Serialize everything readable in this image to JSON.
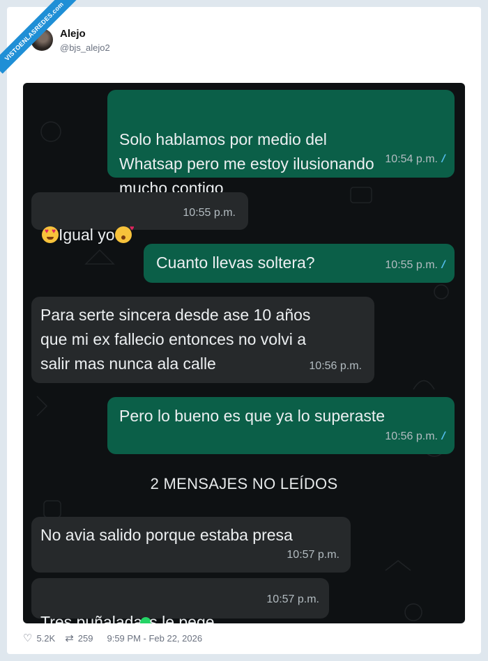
{
  "watermark": "VISTOENLASREDES.com",
  "author": {
    "name": "Alejo",
    "handle": "@bjs_alejo2"
  },
  "messages": [
    {
      "dir": "out",
      "text": "Solo hablamos por medio del\nWhatsap pero me estoy ilusionando\nmucho contigo",
      "time": "10:54 p.m."
    },
    {
      "dir": "in",
      "text": "Igual yo",
      "time": "10:55 p.m."
    },
    {
      "dir": "out",
      "text": "Cuanto llevas soltera?",
      "time": "10:55 p.m."
    },
    {
      "dir": "in",
      "text": "Para serte sincera desde ase 10 años\nque mi ex fallecio entonces no volvi a\nsalir mas nunca ala calle",
      "time": "10:56 p.m."
    },
    {
      "dir": "out",
      "text": "Pero lo bueno es que ya lo superaste",
      "time": "10:56 p.m."
    },
    {
      "dir": "in",
      "text": "No avia salido porque estaba presa",
      "time": "10:57 p.m."
    },
    {
      "dir": "in",
      "text_a": "Tres puñalada",
      "text_b": "s le pege",
      "time": "10:57 p.m."
    }
  ],
  "unread_divider": "2 MENSAJES NO LEÍDOS",
  "stats": {
    "likes": "5.2K",
    "retweets": "259",
    "timestamp": "9:59 PM - Feb 22, 2026"
  },
  "colors": {
    "outgoing_bubble": "#0b5f48",
    "incoming_bubble": "#26292b",
    "chat_background": "#0e1113",
    "read_ticks": "#53bdeb"
  }
}
